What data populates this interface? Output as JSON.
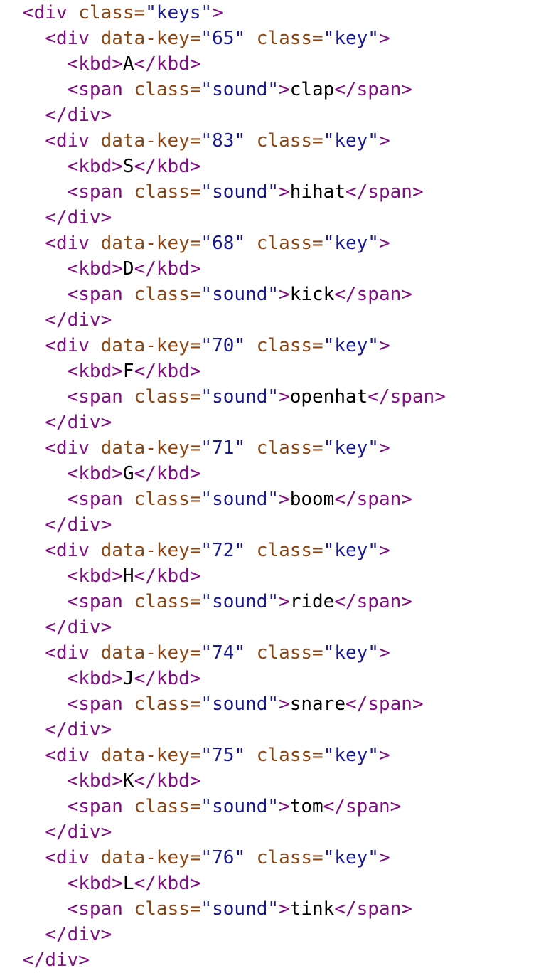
{
  "lines": [
    {
      "indent": "",
      "parts": [
        [
          "tag",
          "<div "
        ],
        [
          "attr",
          "class="
        ],
        [
          "val",
          "\"keys\""
        ],
        [
          "tag",
          ">"
        ]
      ]
    },
    {
      "indent": "  ",
      "parts": [
        [
          "tag",
          "<div "
        ],
        [
          "attr",
          "data-key="
        ],
        [
          "val",
          "\"65\""
        ],
        [
          "tag",
          " "
        ],
        [
          "attr",
          "class="
        ],
        [
          "val",
          "\"key\""
        ],
        [
          "tag",
          ">"
        ]
      ]
    },
    {
      "indent": "    ",
      "parts": [
        [
          "tag",
          "<kbd>"
        ],
        [
          "txt",
          "A"
        ],
        [
          "tag",
          "</kbd>"
        ]
      ]
    },
    {
      "indent": "    ",
      "parts": [
        [
          "tag",
          "<span "
        ],
        [
          "attr",
          "class="
        ],
        [
          "val",
          "\"sound\""
        ],
        [
          "tag",
          ">"
        ],
        [
          "txt",
          "clap"
        ],
        [
          "tag",
          "</span>"
        ]
      ]
    },
    {
      "indent": "  ",
      "parts": [
        [
          "tag",
          "</div>"
        ]
      ]
    },
    {
      "indent": "  ",
      "parts": [
        [
          "tag",
          "<div "
        ],
        [
          "attr",
          "data-key="
        ],
        [
          "val",
          "\"83\""
        ],
        [
          "tag",
          " "
        ],
        [
          "attr",
          "class="
        ],
        [
          "val",
          "\"key\""
        ],
        [
          "tag",
          ">"
        ]
      ]
    },
    {
      "indent": "    ",
      "parts": [
        [
          "tag",
          "<kbd>"
        ],
        [
          "txt",
          "S"
        ],
        [
          "tag",
          "</kbd>"
        ]
      ]
    },
    {
      "indent": "    ",
      "parts": [
        [
          "tag",
          "<span "
        ],
        [
          "attr",
          "class="
        ],
        [
          "val",
          "\"sound\""
        ],
        [
          "tag",
          ">"
        ],
        [
          "txt",
          "hihat"
        ],
        [
          "tag",
          "</span>"
        ]
      ]
    },
    {
      "indent": "  ",
      "parts": [
        [
          "tag",
          "</div>"
        ]
      ]
    },
    {
      "indent": "  ",
      "parts": [
        [
          "tag",
          "<div "
        ],
        [
          "attr",
          "data-key="
        ],
        [
          "val",
          "\"68\""
        ],
        [
          "tag",
          " "
        ],
        [
          "attr",
          "class="
        ],
        [
          "val",
          "\"key\""
        ],
        [
          "tag",
          ">"
        ]
      ]
    },
    {
      "indent": "    ",
      "parts": [
        [
          "tag",
          "<kbd>"
        ],
        [
          "txt",
          "D"
        ],
        [
          "tag",
          "</kbd>"
        ]
      ]
    },
    {
      "indent": "    ",
      "parts": [
        [
          "tag",
          "<span "
        ],
        [
          "attr",
          "class="
        ],
        [
          "val",
          "\"sound\""
        ],
        [
          "tag",
          ">"
        ],
        [
          "txt",
          "kick"
        ],
        [
          "tag",
          "</span>"
        ]
      ]
    },
    {
      "indent": "  ",
      "parts": [
        [
          "tag",
          "</div>"
        ]
      ]
    },
    {
      "indent": "  ",
      "parts": [
        [
          "tag",
          "<div "
        ],
        [
          "attr",
          "data-key="
        ],
        [
          "val",
          "\"70\""
        ],
        [
          "tag",
          " "
        ],
        [
          "attr",
          "class="
        ],
        [
          "val",
          "\"key\""
        ],
        [
          "tag",
          ">"
        ]
      ]
    },
    {
      "indent": "    ",
      "parts": [
        [
          "tag",
          "<kbd>"
        ],
        [
          "txt",
          "F"
        ],
        [
          "tag",
          "</kbd>"
        ]
      ]
    },
    {
      "indent": "    ",
      "parts": [
        [
          "tag",
          "<span "
        ],
        [
          "attr",
          "class="
        ],
        [
          "val",
          "\"sound\""
        ],
        [
          "tag",
          ">"
        ],
        [
          "txt",
          "openhat"
        ],
        [
          "tag",
          "</span>"
        ]
      ]
    },
    {
      "indent": "  ",
      "parts": [
        [
          "tag",
          "</div>"
        ]
      ]
    },
    {
      "indent": "  ",
      "parts": [
        [
          "tag",
          "<div "
        ],
        [
          "attr",
          "data-key="
        ],
        [
          "val",
          "\"71\""
        ],
        [
          "tag",
          " "
        ],
        [
          "attr",
          "class="
        ],
        [
          "val",
          "\"key\""
        ],
        [
          "tag",
          ">"
        ]
      ]
    },
    {
      "indent": "    ",
      "parts": [
        [
          "tag",
          "<kbd>"
        ],
        [
          "txt",
          "G"
        ],
        [
          "tag",
          "</kbd>"
        ]
      ]
    },
    {
      "indent": "    ",
      "parts": [
        [
          "tag",
          "<span "
        ],
        [
          "attr",
          "class="
        ],
        [
          "val",
          "\"sound\""
        ],
        [
          "tag",
          ">"
        ],
        [
          "txt",
          "boom"
        ],
        [
          "tag",
          "</span>"
        ]
      ]
    },
    {
      "indent": "  ",
      "parts": [
        [
          "tag",
          "</div>"
        ]
      ]
    },
    {
      "indent": "  ",
      "parts": [
        [
          "tag",
          "<div "
        ],
        [
          "attr",
          "data-key="
        ],
        [
          "val",
          "\"72\""
        ],
        [
          "tag",
          " "
        ],
        [
          "attr",
          "class="
        ],
        [
          "val",
          "\"key\""
        ],
        [
          "tag",
          ">"
        ]
      ]
    },
    {
      "indent": "    ",
      "parts": [
        [
          "tag",
          "<kbd>"
        ],
        [
          "txt",
          "H"
        ],
        [
          "tag",
          "</kbd>"
        ]
      ]
    },
    {
      "indent": "    ",
      "parts": [
        [
          "tag",
          "<span "
        ],
        [
          "attr",
          "class="
        ],
        [
          "val",
          "\"sound\""
        ],
        [
          "tag",
          ">"
        ],
        [
          "txt",
          "ride"
        ],
        [
          "tag",
          "</span>"
        ]
      ]
    },
    {
      "indent": "  ",
      "parts": [
        [
          "tag",
          "</div>"
        ]
      ]
    },
    {
      "indent": "  ",
      "parts": [
        [
          "tag",
          "<div "
        ],
        [
          "attr",
          "data-key="
        ],
        [
          "val",
          "\"74\""
        ],
        [
          "tag",
          " "
        ],
        [
          "attr",
          "class="
        ],
        [
          "val",
          "\"key\""
        ],
        [
          "tag",
          ">"
        ]
      ]
    },
    {
      "indent": "    ",
      "parts": [
        [
          "tag",
          "<kbd>"
        ],
        [
          "txt",
          "J"
        ],
        [
          "tag",
          "</kbd>"
        ]
      ]
    },
    {
      "indent": "    ",
      "parts": [
        [
          "tag",
          "<span "
        ],
        [
          "attr",
          "class="
        ],
        [
          "val",
          "\"sound\""
        ],
        [
          "tag",
          ">"
        ],
        [
          "txt",
          "snare"
        ],
        [
          "tag",
          "</span>"
        ]
      ]
    },
    {
      "indent": "  ",
      "parts": [
        [
          "tag",
          "</div>"
        ]
      ]
    },
    {
      "indent": "  ",
      "parts": [
        [
          "tag",
          "<div "
        ],
        [
          "attr",
          "data-key="
        ],
        [
          "val",
          "\"75\""
        ],
        [
          "tag",
          " "
        ],
        [
          "attr",
          "class="
        ],
        [
          "val",
          "\"key\""
        ],
        [
          "tag",
          ">"
        ]
      ]
    },
    {
      "indent": "    ",
      "parts": [
        [
          "tag",
          "<kbd>"
        ],
        [
          "txt",
          "K"
        ],
        [
          "tag",
          "</kbd>"
        ]
      ]
    },
    {
      "indent": "    ",
      "parts": [
        [
          "tag",
          "<span "
        ],
        [
          "attr",
          "class="
        ],
        [
          "val",
          "\"sound\""
        ],
        [
          "tag",
          ">"
        ],
        [
          "txt",
          "tom"
        ],
        [
          "tag",
          "</span>"
        ]
      ]
    },
    {
      "indent": "  ",
      "parts": [
        [
          "tag",
          "</div>"
        ]
      ]
    },
    {
      "indent": "  ",
      "parts": [
        [
          "tag",
          "<div "
        ],
        [
          "attr",
          "data-key="
        ],
        [
          "val",
          "\"76\""
        ],
        [
          "tag",
          " "
        ],
        [
          "attr",
          "class="
        ],
        [
          "val",
          "\"key\""
        ],
        [
          "tag",
          ">"
        ]
      ]
    },
    {
      "indent": "    ",
      "parts": [
        [
          "tag",
          "<kbd>"
        ],
        [
          "txt",
          "L"
        ],
        [
          "tag",
          "</kbd>"
        ]
      ]
    },
    {
      "indent": "    ",
      "parts": [
        [
          "tag",
          "<span "
        ],
        [
          "attr",
          "class="
        ],
        [
          "val",
          "\"sound\""
        ],
        [
          "tag",
          ">"
        ],
        [
          "txt",
          "tink"
        ],
        [
          "tag",
          "</span>"
        ]
      ]
    },
    {
      "indent": "  ",
      "parts": [
        [
          "tag",
          "</div>"
        ]
      ]
    },
    {
      "indent": "",
      "parts": [
        [
          "tag",
          "</div>"
        ]
      ]
    }
  ],
  "colors": {
    "tag": "#7f0f82",
    "attr": "#8b4513",
    "val": "#16188c",
    "txt": "#000000",
    "background": "#ffffff"
  }
}
